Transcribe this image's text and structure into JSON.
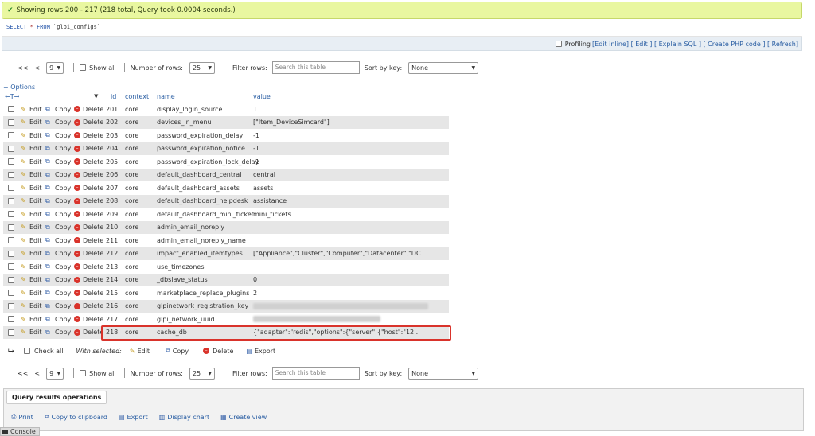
{
  "success": {
    "message": "Showing rows 200 - 217 (218 total, Query took 0.0004 seconds.)"
  },
  "sql": {
    "keyword": "SELECT",
    "op": "*",
    "from": "FROM",
    "table": "`glpi_configs`"
  },
  "toolsbar": {
    "profiling": "Profiling",
    "links": [
      "[Edit inline]",
      "[ Edit ]",
      "[ Explain SQL ]",
      "[ Create PHP code ]",
      "[ Refresh]"
    ]
  },
  "nav": {
    "first": "<<",
    "prev": "<",
    "page": "9",
    "show_all": "Show all",
    "num_rows_label": "Number of rows:",
    "num_rows": "25",
    "filter_label": "Filter rows:",
    "filter_placeholder": "Search this table",
    "sort_label": "Sort by key:",
    "sort_value": "None"
  },
  "options_link": "+ Options",
  "table": {
    "headers": {
      "id": "id",
      "context": "context",
      "name": "name",
      "value": "value"
    },
    "action_labels": {
      "edit": "Edit",
      "copy": "Copy",
      "delete": "Delete"
    },
    "rows": [
      {
        "id": "201",
        "context": "core",
        "name": "display_login_source",
        "value": "1"
      },
      {
        "id": "202",
        "context": "core",
        "name": "devices_in_menu",
        "value": "[\"Item_DeviceSimcard\"]"
      },
      {
        "id": "203",
        "context": "core",
        "name": "password_expiration_delay",
        "value": "-1"
      },
      {
        "id": "204",
        "context": "core",
        "name": "password_expiration_notice",
        "value": "-1"
      },
      {
        "id": "205",
        "context": "core",
        "name": "password_expiration_lock_delay",
        "value": "-1"
      },
      {
        "id": "206",
        "context": "core",
        "name": "default_dashboard_central",
        "value": "central"
      },
      {
        "id": "207",
        "context": "core",
        "name": "default_dashboard_assets",
        "value": "assets"
      },
      {
        "id": "208",
        "context": "core",
        "name": "default_dashboard_helpdesk",
        "value": "assistance"
      },
      {
        "id": "209",
        "context": "core",
        "name": "default_dashboard_mini_ticket",
        "value": "mini_tickets"
      },
      {
        "id": "210",
        "context": "core",
        "name": "admin_email_noreply",
        "value": ""
      },
      {
        "id": "211",
        "context": "core",
        "name": "admin_email_noreply_name",
        "value": ""
      },
      {
        "id": "212",
        "context": "core",
        "name": "impact_enabled_itemtypes",
        "value": "[\"Appliance\",\"Cluster\",\"Computer\",\"Datacenter\",\"DC..."
      },
      {
        "id": "213",
        "context": "core",
        "name": "use_timezones",
        "value": ""
      },
      {
        "id": "214",
        "context": "core",
        "name": "_dbslave_status",
        "value": "0"
      },
      {
        "id": "215",
        "context": "core",
        "name": "marketplace_replace_plugins",
        "value": "2"
      },
      {
        "id": "216",
        "context": "core",
        "name": "glpinetwork_registration_key",
        "value": ""
      },
      {
        "id": "217",
        "context": "core",
        "name": "glpi_network_uuid",
        "value": ""
      },
      {
        "id": "218",
        "context": "core",
        "name": "cache_db",
        "value": "{\"adapter\":\"redis\",\"options\":{\"server\":{\"host\":\"12..."
      }
    ]
  },
  "with_selected": {
    "check_all": "Check all",
    "label": "With selected:",
    "edit": "Edit",
    "copy": "Copy",
    "delete": "Delete",
    "export": "Export"
  },
  "qro": {
    "legend": "Query results operations",
    "links": [
      "Print",
      "Copy to clipboard",
      "Export",
      "Display chart",
      "Create view"
    ]
  },
  "console": "Console"
}
